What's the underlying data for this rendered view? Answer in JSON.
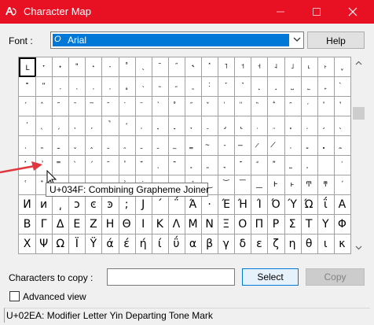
{
  "window": {
    "title": "Character Map"
  },
  "font": {
    "label": "Font :",
    "selected": "Arial",
    "icon_glyph": "O"
  },
  "help_label": "Help",
  "grid": {
    "rows": [
      [
        "L",
        "˕",
        "˖",
        "\"",
        "˔",
        "˗",
        "˚",
        "˛",
        "˜",
        "˝",
        "˞",
        "˟",
        "˥",
        "˦",
        "˧",
        "˨",
        "˩",
        "˪",
        "˫",
        "ˬ"
      ],
      [
        "˭",
        "ˮ",
        "˯",
        "˰",
        "˱",
        "˲",
        "˳",
        "˴",
        "˵",
        "˶",
        "˷",
        "˸",
        "˹",
        "˺",
        "˻",
        "˼",
        "˽",
        "˾",
        "˿",
        "̀"
      ],
      [
        "́",
        "̂",
        "̃",
        "̄",
        "̅",
        "̆",
        "̇",
        "̈",
        "̉",
        "̊",
        "̋",
        "̌",
        "̍",
        "̎",
        "̏",
        "̐",
        "̑",
        "̒",
        "̓",
        "̔"
      ],
      [
        "̕",
        "̖",
        "̗",
        "̘",
        "̙",
        "̚",
        "̛",
        "̜",
        "̝",
        "̞",
        "̟",
        "̠",
        "̡",
        "̢",
        "̣",
        "̤",
        "̥",
        "̦",
        "̧",
        "̨"
      ],
      [
        "̩",
        "̪",
        "̫",
        "̬",
        "̭",
        "̮",
        "̯",
        "̰",
        "̱",
        "̲",
        "̳",
        "̴",
        "̵",
        "̶",
        "̷",
        "̸",
        "̹",
        "̺",
        "̻",
        "̼"
      ],
      [
        "̽",
        "̾",
        "̿",
        "̀",
        "́",
        "͂",
        "̓",
        "̈́",
        "ͅ",
        "͆",
        "͇",
        "͈",
        "͉",
        "͊",
        "͋",
        "͌",
        "͍",
        "͎",
        "͏",
        "͐"
      ],
      [
        "͑",
        "͒",
        "͓",
        "͔",
        "͕",
        "͖",
        "͗",
        "͘",
        "͙",
        "͚",
        "͛",
        "͜",
        "͝",
        "͞",
        "͟",
        "Ͱ",
        "ͱ",
        "Ͳ",
        "ͳ",
        "´"
      ],
      [
        "Ͷ",
        "ͷ",
        "͵",
        "ͻ",
        "ͼ",
        "ͽ",
        ";",
        "Ϳ",
        "΄",
        "΅",
        "Ά",
        "·",
        "Έ",
        "Ή",
        "Ί",
        "Ό",
        "Ύ",
        "Ώ",
        "ΐ",
        "Α"
      ],
      [
        "Β",
        "Γ",
        "Δ",
        "Ε",
        "Ζ",
        "Η",
        "Θ",
        "Ι",
        "Κ",
        "Λ",
        "Μ",
        "Ν",
        "Ξ",
        "Ο",
        "Π",
        "Ρ",
        "Σ",
        "Τ",
        "Υ",
        "Φ"
      ],
      [
        "Χ",
        "Ψ",
        "Ω",
        "Ϊ",
        "Ϋ",
        "ά",
        "έ",
        "ή",
        "ί",
        "ΰ",
        "α",
        "β",
        "γ",
        "δ",
        "ε",
        "ζ",
        "η",
        "θ",
        "ι",
        "κ"
      ]
    ],
    "selected_row": 0,
    "selected_col": 0
  },
  "tooltip": "U+034F: Combining Grapheme Joiner",
  "copy": {
    "label": "Characters to copy :",
    "value": "",
    "select_label": "Select",
    "copy_label": "Copy"
  },
  "advanced": {
    "label": "Advanced view",
    "checked": false
  },
  "status": "U+02EA: Modifier Letter Yin Departing Tone Mark",
  "colors": {
    "titlebar": "#e81123",
    "selection": "#0078d7",
    "annotation_arrow": "#e0363d"
  }
}
